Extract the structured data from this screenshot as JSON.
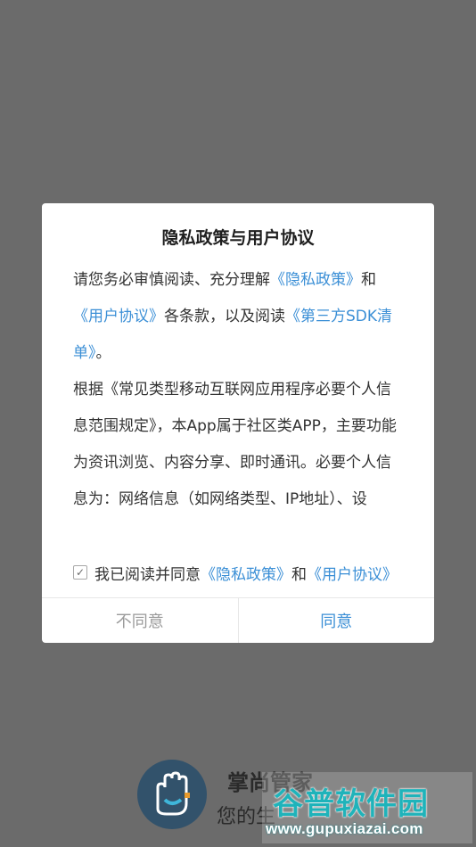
{
  "dialog": {
    "title": "隐私政策与用户协议",
    "intro": {
      "t1": "请您务必审慎阅读、充分理解",
      "link_privacy": "《隐私政策》",
      "t2": "和",
      "link_user": "《用户协议》",
      "t3": "各条款，以及阅读",
      "link_sdk": "《第三方SDK清单》",
      "t4": "。"
    },
    "para2": "根据《常见类型移动互联网应用程序必要个人信息范围规定》，本App属于社区类APP，主要功能为资讯浏览、内容分享、即时通讯。必要个人信息为：网络信息（如网络类型、IP地址）、设",
    "agree": {
      "checked_glyph": "✓",
      "text": "我已阅读并同意",
      "link_privacy": "《隐私政策》",
      "and": "和",
      "link_user": "《用户协议》"
    },
    "buttons": {
      "disagree": "不同意",
      "agree": "同意"
    }
  },
  "splash": {
    "app_name": "掌尚管家",
    "slogan": "您的生"
  },
  "watermark": {
    "title": "谷普软件园",
    "url": "www.gupuxiazai.com"
  },
  "colors": {
    "link": "#3b8fd6",
    "overlay": "#6b6b6b",
    "watermark_title": "#1fb3ba"
  }
}
